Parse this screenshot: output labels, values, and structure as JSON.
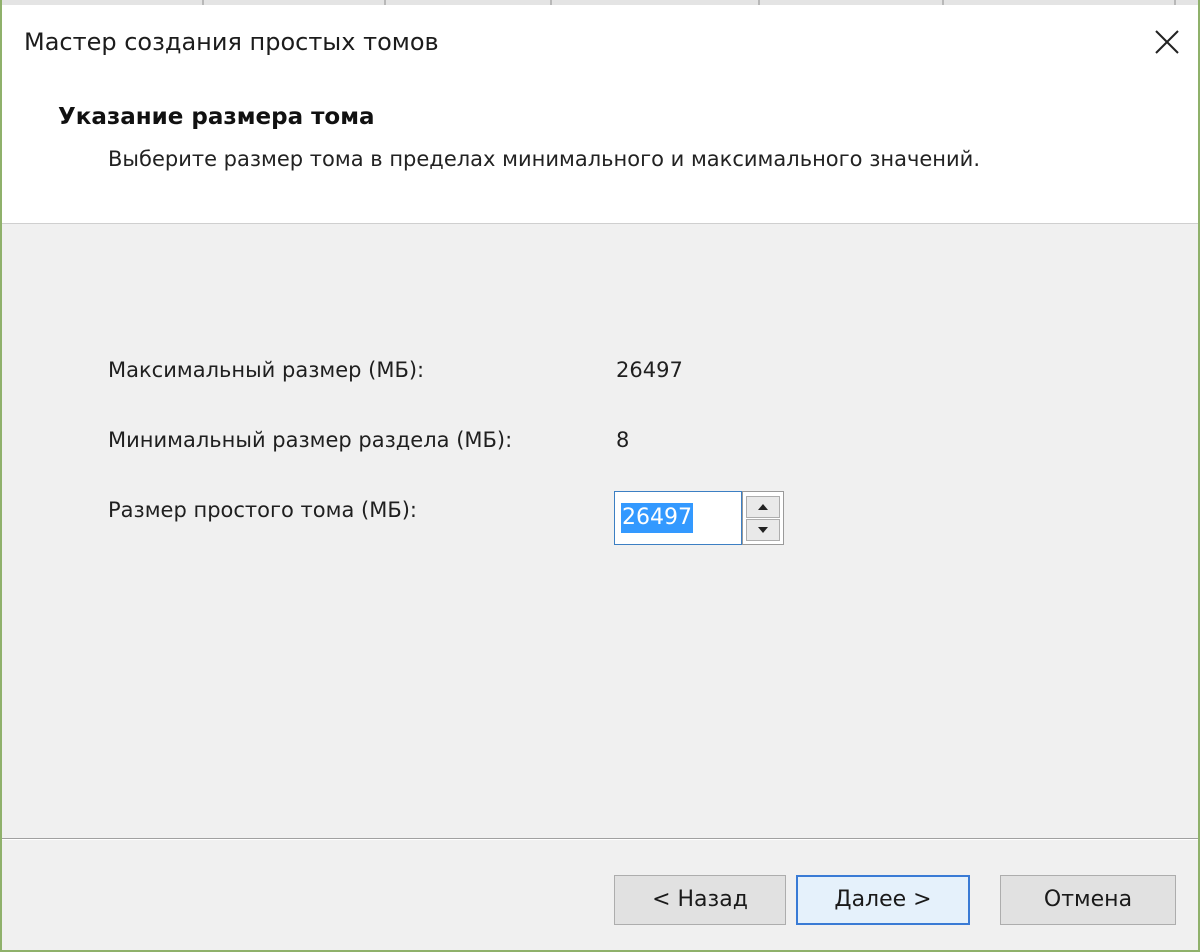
{
  "window": {
    "title": "Мастер создания простых томов"
  },
  "header": {
    "title": "Указание размера тома",
    "description": "Выберите размер тома в пределах минимального и максимального значений."
  },
  "fields": {
    "max_size": {
      "label": "Максимальный размер (МБ):",
      "value": "26497"
    },
    "min_size": {
      "label": "Минимальный размер раздела (МБ):",
      "value": "8"
    },
    "volume_size": {
      "label": "Размер простого тома (МБ):",
      "value": "26497"
    }
  },
  "buttons": {
    "back": "< Назад",
    "next": "Далее >",
    "cancel": "Отмена"
  },
  "icons": {
    "close": "close-icon",
    "spin_up": "arrow-up-icon",
    "spin_down": "arrow-down-icon"
  },
  "colors": {
    "window_border": "#8fb16b",
    "selection": "#3399ff",
    "focus_border": "#3a7bd5"
  }
}
